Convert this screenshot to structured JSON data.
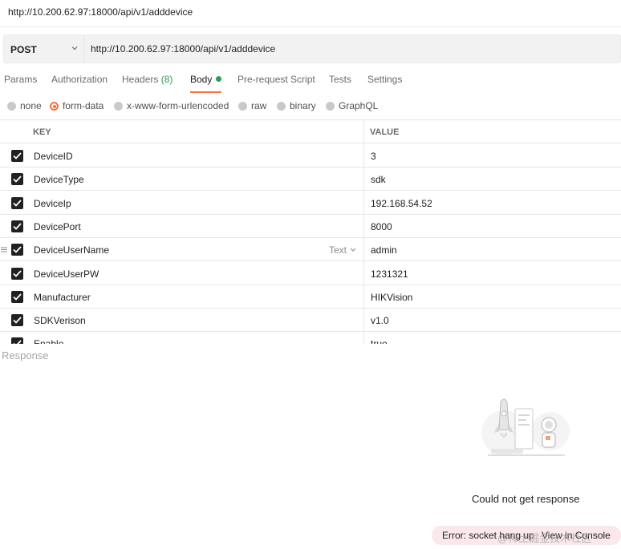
{
  "title_url": "http://10.200.62.97:18000/api/v1/adddevice",
  "request": {
    "method": "POST",
    "url": "http://10.200.62.97:18000/api/v1/adddevice"
  },
  "tabs": {
    "params": "Params",
    "authorization": "Authorization",
    "headers": "Headers",
    "headers_count": "(8)",
    "body": "Body",
    "pre_request": "Pre-request Script",
    "tests": "Tests",
    "settings": "Settings"
  },
  "body_types": {
    "none": "none",
    "form_data": "form-data",
    "urlencoded": "x-www-form-urlencoded",
    "raw": "raw",
    "binary": "binary",
    "graphql": "GraphQL",
    "selected": "form-data"
  },
  "table": {
    "key_header": "KEY",
    "value_header": "VALUE",
    "type_label": "Text",
    "rows": [
      {
        "key": "DeviceID",
        "value": "3",
        "checked": true
      },
      {
        "key": "DeviceType",
        "value": "sdk",
        "checked": true
      },
      {
        "key": "DeviceIp",
        "value": "192.168.54.52",
        "checked": true
      },
      {
        "key": "DevicePort",
        "value": "8000",
        "checked": true
      },
      {
        "key": "DeviceUserName",
        "value": "admin",
        "checked": true
      },
      {
        "key": "DeviceUserPW",
        "value": "1231321",
        "checked": true
      },
      {
        "key": "Manufacturer",
        "value": "HIKVision",
        "checked": true
      },
      {
        "key": "SDKVerison",
        "value": "v1.0",
        "checked": true
      },
      {
        "key": "Enable",
        "value": "true",
        "checked": true
      }
    ]
  },
  "response": {
    "label": "Response",
    "empty_message": "Could not get response",
    "error_text": "Error: socket hang up",
    "console_link": "View in Console"
  },
  "watermark": "@稀土掘金技术社区",
  "colors": {
    "accent": "#ff6c37",
    "success": "#2c9d51",
    "error_bg": "#fbe8e8"
  }
}
